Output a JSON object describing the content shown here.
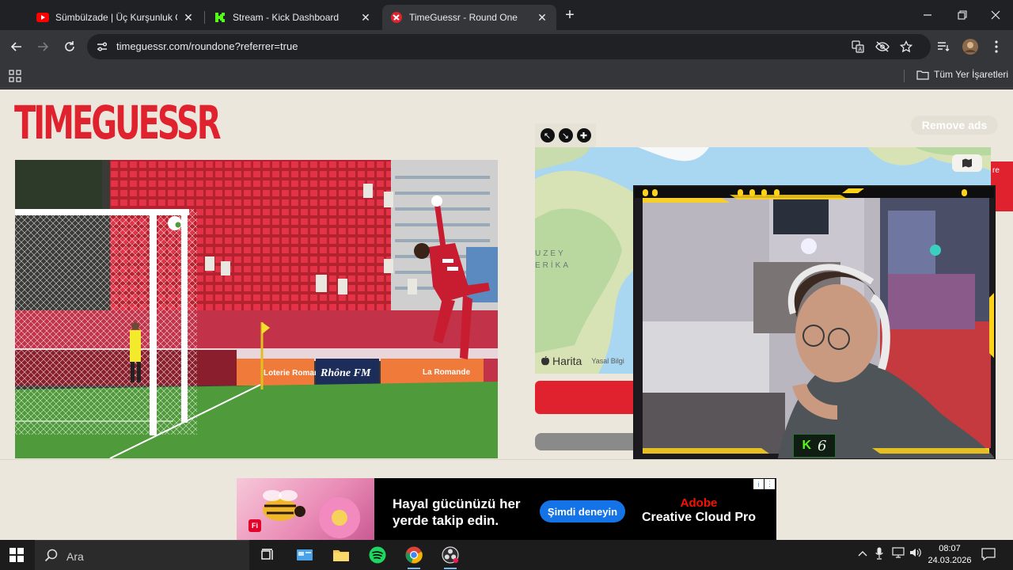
{
  "browser": {
    "tabs": [
      {
        "title": "Sümbülzade | Üç Kurşunluk Operasyon",
        "active": false
      },
      {
        "title": "Stream - Kick Dashboard",
        "active": false
      },
      {
        "title": "TimeGuessr - Round One",
        "active": true
      }
    ],
    "close_glyph": "✕",
    "new_tab_glyph": "+",
    "url": "timeguessr.com/roundone?referrer=true",
    "bookmarks_all": "Tüm Yer İşaretleri"
  },
  "page": {
    "logo": "TIMEGUESSR",
    "remove_ads": "Remove ads",
    "map": {
      "label_line1": "UZEY",
      "label_line2": "ERİKA",
      "brand": "Harita",
      "legal": "Yasal Bilgi",
      "side_tab_text": "re"
    },
    "photo": {
      "ad_boards": [
        "Loterie Romande",
        "Rhône FM",
        "La Romande"
      ]
    }
  },
  "stream_overlay": {
    "viewer_count": "6"
  },
  "ad": {
    "headline_line1": "Hayal gücünüzü her",
    "headline_line2": "yerde takip edin.",
    "cta": "Şimdi deneyin",
    "brand": "Adobe",
    "product": "Creative Cloud Pro",
    "badge": "Fi"
  },
  "taskbar": {
    "search_placeholder": "Ara",
    "time": "08:07",
    "date": "24.03.2026"
  },
  "colors": {
    "brand_red": "#e0222e",
    "page_bg": "#ebe7dc",
    "kick_green": "#53fc18",
    "adobe_red": "#fa0f00",
    "cta_blue": "#1473e6"
  }
}
